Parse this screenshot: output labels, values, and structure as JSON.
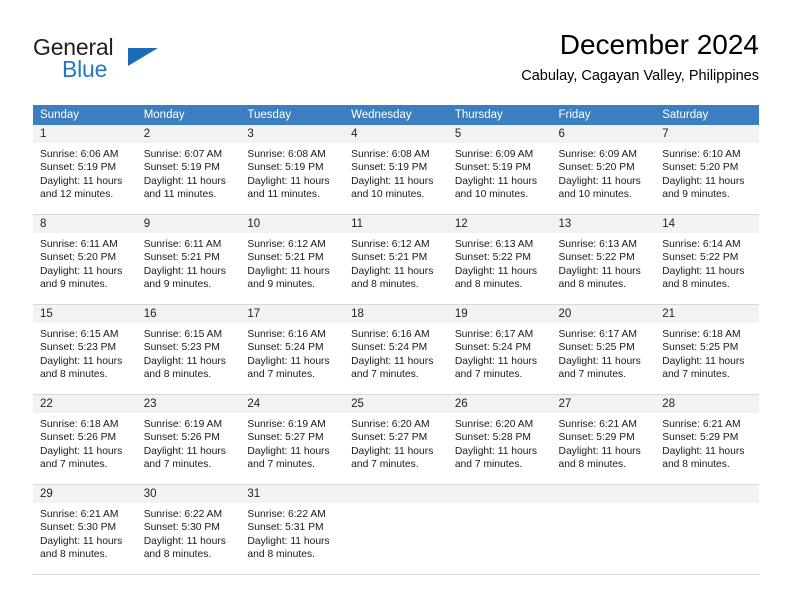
{
  "branding": {
    "name_dark": "General",
    "name_blue": "Blue",
    "accent_color": "#1b6cb5"
  },
  "header": {
    "title": "December 2024",
    "subtitle": "Cabulay, Cagayan Valley, Philippines"
  },
  "theme": {
    "header_band": "#3c7ebf",
    "daynum_band": "#f2f2f2",
    "text": "#000000"
  },
  "weekday_headers": [
    "Sunday",
    "Monday",
    "Tuesday",
    "Wednesday",
    "Thursday",
    "Friday",
    "Saturday"
  ],
  "weeks": [
    [
      {
        "day": "1",
        "sunrise": "Sunrise: 6:06 AM",
        "sunset": "Sunset: 5:19 PM",
        "daylight_line1": "Daylight: 11 hours",
        "daylight_line2": "and 12 minutes."
      },
      {
        "day": "2",
        "sunrise": "Sunrise: 6:07 AM",
        "sunset": "Sunset: 5:19 PM",
        "daylight_line1": "Daylight: 11 hours",
        "daylight_line2": "and 11 minutes."
      },
      {
        "day": "3",
        "sunrise": "Sunrise: 6:08 AM",
        "sunset": "Sunset: 5:19 PM",
        "daylight_line1": "Daylight: 11 hours",
        "daylight_line2": "and 11 minutes."
      },
      {
        "day": "4",
        "sunrise": "Sunrise: 6:08 AM",
        "sunset": "Sunset: 5:19 PM",
        "daylight_line1": "Daylight: 11 hours",
        "daylight_line2": "and 10 minutes."
      },
      {
        "day": "5",
        "sunrise": "Sunrise: 6:09 AM",
        "sunset": "Sunset: 5:19 PM",
        "daylight_line1": "Daylight: 11 hours",
        "daylight_line2": "and 10 minutes."
      },
      {
        "day": "6",
        "sunrise": "Sunrise: 6:09 AM",
        "sunset": "Sunset: 5:20 PM",
        "daylight_line1": "Daylight: 11 hours",
        "daylight_line2": "and 10 minutes."
      },
      {
        "day": "7",
        "sunrise": "Sunrise: 6:10 AM",
        "sunset": "Sunset: 5:20 PM",
        "daylight_line1": "Daylight: 11 hours",
        "daylight_line2": "and 9 minutes."
      }
    ],
    [
      {
        "day": "8",
        "sunrise": "Sunrise: 6:11 AM",
        "sunset": "Sunset: 5:20 PM",
        "daylight_line1": "Daylight: 11 hours",
        "daylight_line2": "and 9 minutes."
      },
      {
        "day": "9",
        "sunrise": "Sunrise: 6:11 AM",
        "sunset": "Sunset: 5:21 PM",
        "daylight_line1": "Daylight: 11 hours",
        "daylight_line2": "and 9 minutes."
      },
      {
        "day": "10",
        "sunrise": "Sunrise: 6:12 AM",
        "sunset": "Sunset: 5:21 PM",
        "daylight_line1": "Daylight: 11 hours",
        "daylight_line2": "and 9 minutes."
      },
      {
        "day": "11",
        "sunrise": "Sunrise: 6:12 AM",
        "sunset": "Sunset: 5:21 PM",
        "daylight_line1": "Daylight: 11 hours",
        "daylight_line2": "and 8 minutes."
      },
      {
        "day": "12",
        "sunrise": "Sunrise: 6:13 AM",
        "sunset": "Sunset: 5:22 PM",
        "daylight_line1": "Daylight: 11 hours",
        "daylight_line2": "and 8 minutes."
      },
      {
        "day": "13",
        "sunrise": "Sunrise: 6:13 AM",
        "sunset": "Sunset: 5:22 PM",
        "daylight_line1": "Daylight: 11 hours",
        "daylight_line2": "and 8 minutes."
      },
      {
        "day": "14",
        "sunrise": "Sunrise: 6:14 AM",
        "sunset": "Sunset: 5:22 PM",
        "daylight_line1": "Daylight: 11 hours",
        "daylight_line2": "and 8 minutes."
      }
    ],
    [
      {
        "day": "15",
        "sunrise": "Sunrise: 6:15 AM",
        "sunset": "Sunset: 5:23 PM",
        "daylight_line1": "Daylight: 11 hours",
        "daylight_line2": "and 8 minutes."
      },
      {
        "day": "16",
        "sunrise": "Sunrise: 6:15 AM",
        "sunset": "Sunset: 5:23 PM",
        "daylight_line1": "Daylight: 11 hours",
        "daylight_line2": "and 8 minutes."
      },
      {
        "day": "17",
        "sunrise": "Sunrise: 6:16 AM",
        "sunset": "Sunset: 5:24 PM",
        "daylight_line1": "Daylight: 11 hours",
        "daylight_line2": "and 7 minutes."
      },
      {
        "day": "18",
        "sunrise": "Sunrise: 6:16 AM",
        "sunset": "Sunset: 5:24 PM",
        "daylight_line1": "Daylight: 11 hours",
        "daylight_line2": "and 7 minutes."
      },
      {
        "day": "19",
        "sunrise": "Sunrise: 6:17 AM",
        "sunset": "Sunset: 5:24 PM",
        "daylight_line1": "Daylight: 11 hours",
        "daylight_line2": "and 7 minutes."
      },
      {
        "day": "20",
        "sunrise": "Sunrise: 6:17 AM",
        "sunset": "Sunset: 5:25 PM",
        "daylight_line1": "Daylight: 11 hours",
        "daylight_line2": "and 7 minutes."
      },
      {
        "day": "21",
        "sunrise": "Sunrise: 6:18 AM",
        "sunset": "Sunset: 5:25 PM",
        "daylight_line1": "Daylight: 11 hours",
        "daylight_line2": "and 7 minutes."
      }
    ],
    [
      {
        "day": "22",
        "sunrise": "Sunrise: 6:18 AM",
        "sunset": "Sunset: 5:26 PM",
        "daylight_line1": "Daylight: 11 hours",
        "daylight_line2": "and 7 minutes."
      },
      {
        "day": "23",
        "sunrise": "Sunrise: 6:19 AM",
        "sunset": "Sunset: 5:26 PM",
        "daylight_line1": "Daylight: 11 hours",
        "daylight_line2": "and 7 minutes."
      },
      {
        "day": "24",
        "sunrise": "Sunrise: 6:19 AM",
        "sunset": "Sunset: 5:27 PM",
        "daylight_line1": "Daylight: 11 hours",
        "daylight_line2": "and 7 minutes."
      },
      {
        "day": "25",
        "sunrise": "Sunrise: 6:20 AM",
        "sunset": "Sunset: 5:27 PM",
        "daylight_line1": "Daylight: 11 hours",
        "daylight_line2": "and 7 minutes."
      },
      {
        "day": "26",
        "sunrise": "Sunrise: 6:20 AM",
        "sunset": "Sunset: 5:28 PM",
        "daylight_line1": "Daylight: 11 hours",
        "daylight_line2": "and 7 minutes."
      },
      {
        "day": "27",
        "sunrise": "Sunrise: 6:21 AM",
        "sunset": "Sunset: 5:29 PM",
        "daylight_line1": "Daylight: 11 hours",
        "daylight_line2": "and 8 minutes."
      },
      {
        "day": "28",
        "sunrise": "Sunrise: 6:21 AM",
        "sunset": "Sunset: 5:29 PM",
        "daylight_line1": "Daylight: 11 hours",
        "daylight_line2": "and 8 minutes."
      }
    ],
    [
      {
        "day": "29",
        "sunrise": "Sunrise: 6:21 AM",
        "sunset": "Sunset: 5:30 PM",
        "daylight_line1": "Daylight: 11 hours",
        "daylight_line2": "and 8 minutes."
      },
      {
        "day": "30",
        "sunrise": "Sunrise: 6:22 AM",
        "sunset": "Sunset: 5:30 PM",
        "daylight_line1": "Daylight: 11 hours",
        "daylight_line2": "and 8 minutes."
      },
      {
        "day": "31",
        "sunrise": "Sunrise: 6:22 AM",
        "sunset": "Sunset: 5:31 PM",
        "daylight_line1": "Daylight: 11 hours",
        "daylight_line2": "and 8 minutes."
      },
      {
        "day": "",
        "sunrise": "",
        "sunset": "",
        "daylight_line1": "",
        "daylight_line2": ""
      },
      {
        "day": "",
        "sunrise": "",
        "sunset": "",
        "daylight_line1": "",
        "daylight_line2": ""
      },
      {
        "day": "",
        "sunrise": "",
        "sunset": "",
        "daylight_line1": "",
        "daylight_line2": ""
      },
      {
        "day": "",
        "sunrise": "",
        "sunset": "",
        "daylight_line1": "",
        "daylight_line2": ""
      }
    ]
  ]
}
